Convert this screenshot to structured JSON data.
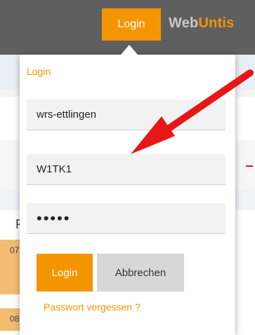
{
  "topbar": {
    "login_tab": "Login",
    "brand_part1": "Web",
    "brand_part2": "Untis"
  },
  "background": {
    "left_letter": "F",
    "row1_number": "07",
    "row2_number": "08"
  },
  "dropdown": {
    "title": "Login",
    "school_value": "wrs-ettlingen",
    "username_value": "W1TK1",
    "password_value": "•••••",
    "login_button": "Login",
    "cancel_button": "Abbrechen",
    "forgot_link": "Passwort vergessen ?"
  },
  "colors": {
    "accent": "#f49500",
    "topbar": "#5f5f5f",
    "arrow": "#e81616"
  }
}
